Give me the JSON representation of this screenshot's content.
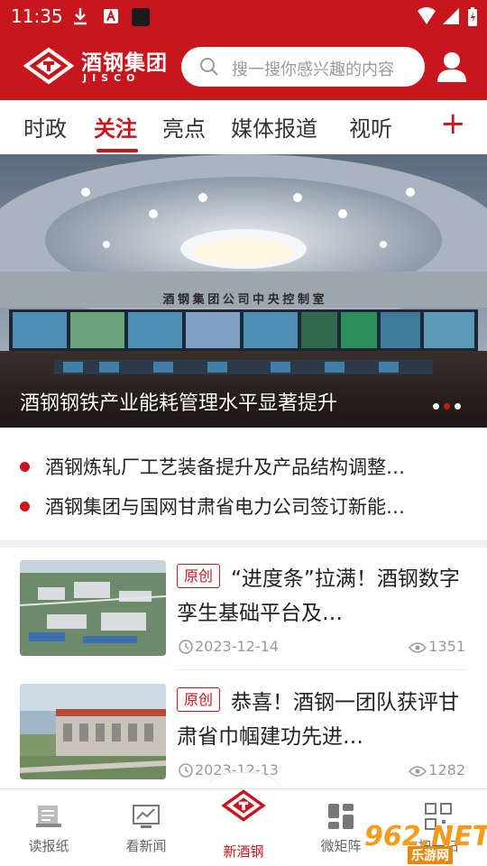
{
  "status_bar": {
    "time": "11:35"
  },
  "brand": {
    "name_cn": "酒钢集团",
    "name_en": "JISCO"
  },
  "search": {
    "placeholder": "搜一搜你感兴趣的内容"
  },
  "tabs": [
    {
      "label": "时政",
      "active": false
    },
    {
      "label": "关注",
      "active": true
    },
    {
      "label": "亮点",
      "active": false
    },
    {
      "label": "媒体报道",
      "active": false
    },
    {
      "label": "视听",
      "active": false
    }
  ],
  "tabs_more": "+",
  "banner": {
    "caption": "酒钢钢铁产业能耗管理水平显著提升",
    "wall_sign": "酒 钢 集 团 公 司 中 央 控 制 室",
    "page_count": 3,
    "active_page": 2
  },
  "headlines": [
    "酒钢炼轧厂工艺装备提升及产品结构调整…",
    "酒钢集团与国网甘肃省电力公司签订新能…"
  ],
  "news": [
    {
      "tag": "原创",
      "title": "“进度条”拉满！酒钢数字孪生基础平台及…",
      "date": "2023-12-14",
      "views": "1351"
    },
    {
      "tag": "原创",
      "title": "恭喜！酒钢一团队获评甘肃省巾帼建功先进…",
      "date": "2023-12-13",
      "views": "1282"
    }
  ],
  "bottom_nav": [
    {
      "label": "读报纸",
      "icon": "newspaper-icon",
      "active": false
    },
    {
      "label": "看新闻",
      "icon": "chart-news-icon",
      "active": false
    },
    {
      "label": "新酒钢",
      "icon": "jisco-logo-icon",
      "active": true
    },
    {
      "label": "微矩阵",
      "icon": "grid-icon",
      "active": false
    },
    {
      "label": "扫一扫",
      "icon": "qr-icon",
      "active": false
    }
  ],
  "watermark": {
    "text": "962.NET",
    "sub": "乐游网"
  },
  "colors": {
    "brand_red": "#c8161d",
    "muted_text": "#9a9a9a"
  }
}
